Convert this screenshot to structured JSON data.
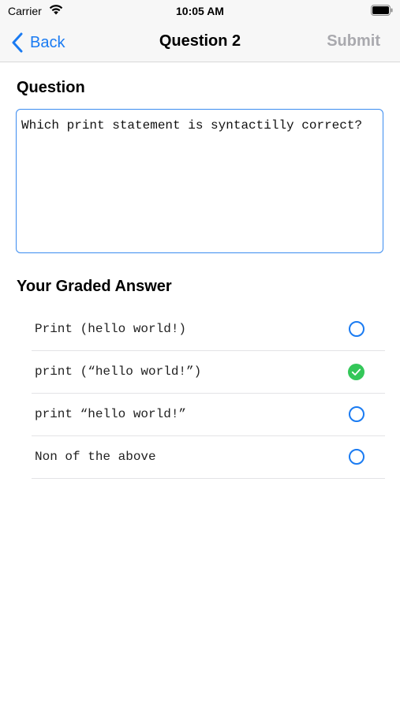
{
  "status_bar": {
    "carrier": "Carrier",
    "time": "10:05 AM"
  },
  "nav": {
    "back_label": "Back",
    "title": "Question 2",
    "submit_label": "Submit"
  },
  "question": {
    "label": "Question",
    "text": "Which print statement is syntactilly correct?"
  },
  "answers": {
    "label": "Your Graded Answer",
    "options": [
      {
        "text": "Print (hello world!)",
        "selected": false
      },
      {
        "text": "print (“hello world!”)",
        "selected": true
      },
      {
        "text": "print “hello world!”",
        "selected": false
      },
      {
        "text": "Non of the above",
        "selected": false
      }
    ]
  },
  "colors": {
    "accent": "#1a7bf2",
    "check_green": "#34c759",
    "disabled": "#a9a9ae"
  }
}
